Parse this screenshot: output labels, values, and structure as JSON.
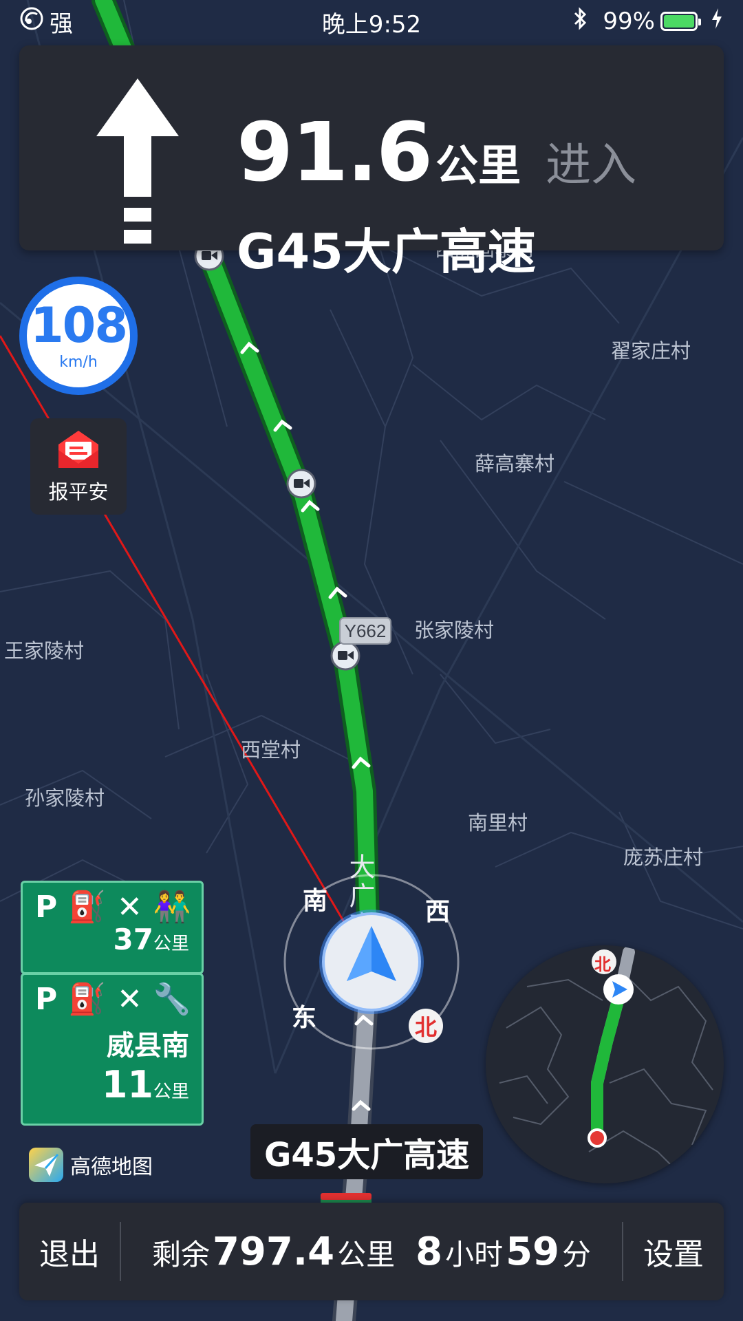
{
  "status_bar": {
    "signal_label": "强",
    "time": "晚上9:52",
    "battery_percent": "99%",
    "battery_level": 0.99,
    "icons": [
      "wifi-signal-icon",
      "bluetooth-icon",
      "battery-icon",
      "charging-bolt-icon"
    ]
  },
  "guidance": {
    "maneuver_icon": "straight-arrow-icon",
    "distance_value": "91.6",
    "distance_unit": "公里",
    "action": "进入",
    "road_name": "G45大广高速"
  },
  "speed_limit": {
    "value": "108",
    "unit": "km/h"
  },
  "safety_button": {
    "label": "报平安",
    "icon": "envelope-icon"
  },
  "map_labels": [
    "西陈固寨村",
    "翟家庄村",
    "薛高寨村",
    "张家陵村",
    "王家陵村",
    "西堂村",
    "孙家陵村",
    "南里村",
    "庞苏庄村",
    "大广高速"
  ],
  "road_shield": "Y662",
  "service_area_1": {
    "icons": [
      "parking-icon",
      "fuel-icon",
      "restaurant-icon",
      "toilet-icon"
    ],
    "distance_value": "37",
    "distance_unit": "公里"
  },
  "service_area_2": {
    "icons": [
      "parking-icon",
      "fuel-icon",
      "restaurant-icon",
      "repair-icon"
    ],
    "name": "威县南",
    "distance_value": "11",
    "distance_unit": "公里"
  },
  "compass": {
    "south": "南",
    "west": "西",
    "east": "东",
    "north": "北"
  },
  "minimap": {
    "north_label": "北"
  },
  "current_road": "G45大广高速",
  "brand": {
    "name": "高德地图"
  },
  "bottom_bar": {
    "exit_label": "退出",
    "remaining_prefix": "剩余",
    "remaining_distance": "797.4",
    "distance_unit": "公里",
    "hours": "8",
    "hours_unit": "小时",
    "minutes": "59",
    "minutes_unit": "分",
    "settings_label": "设置"
  },
  "colors": {
    "map_bg": "#1f2b45",
    "route_green": "#20b83a",
    "panel_bg": "#272a33",
    "speed_blue": "#1f6fe8",
    "sign_green": "#0d8a5c"
  }
}
